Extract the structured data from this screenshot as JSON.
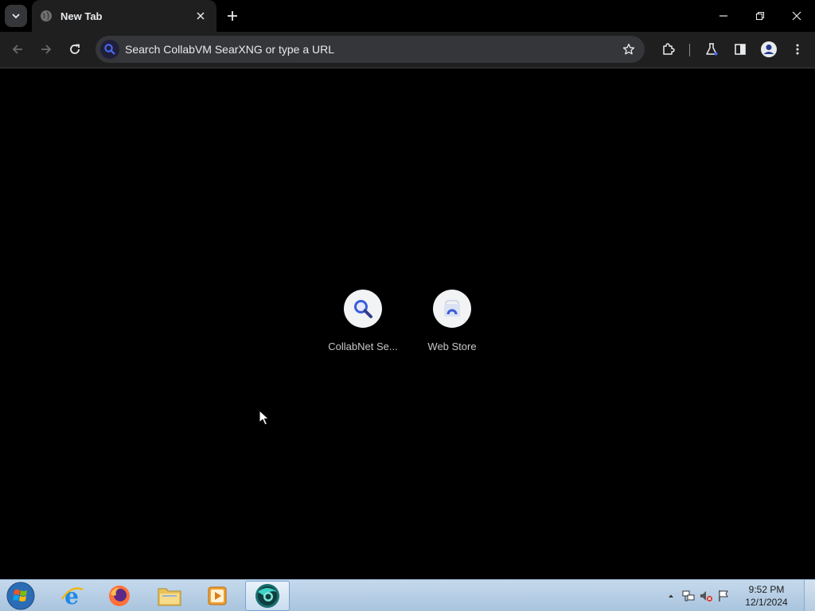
{
  "browser": {
    "tab": {
      "title": "New Tab"
    },
    "omnibox": {
      "placeholder": "Search CollabVM SearXNG or type a URL"
    }
  },
  "new_tab_page": {
    "shortcuts": [
      {
        "label": "CollabNet Se...",
        "icon": "search-icon"
      },
      {
        "label": "Web Store",
        "icon": "web-store-icon"
      }
    ]
  },
  "taskbar": {
    "apps": [
      "internet-explorer",
      "firefox",
      "file-explorer",
      "media-player",
      "chrome"
    ],
    "clock": {
      "time": "9:52 PM",
      "date": "12/1/2024"
    }
  },
  "colors": {
    "accent_blue": "#3b5bdb",
    "page_background": "#000000",
    "toolbar_background": "#1f1f1f"
  }
}
